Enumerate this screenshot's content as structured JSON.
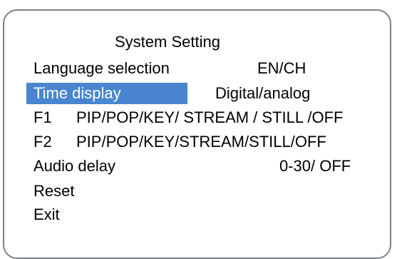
{
  "menu": {
    "title": "System Setting",
    "items": [
      {
        "label": "Language selection",
        "value": "EN/CH"
      },
      {
        "label": "Time display",
        "value": "Digital/analog",
        "selected": true
      },
      {
        "key": "F1",
        "value": "PIP/POP/KEY/ STREAM / STILL /OFF"
      },
      {
        "key": "F2",
        "value": "PIP/POP/KEY/STREAM/STILL/OFF"
      },
      {
        "label": "Audio delay",
        "value": "0-30/ OFF"
      },
      {
        "label": "Reset"
      },
      {
        "label": "Exit"
      }
    ]
  },
  "colors": {
    "highlight": "#4a86cf",
    "border": "#7a8189",
    "text": "#000000",
    "selected_text": "#ffffff"
  }
}
